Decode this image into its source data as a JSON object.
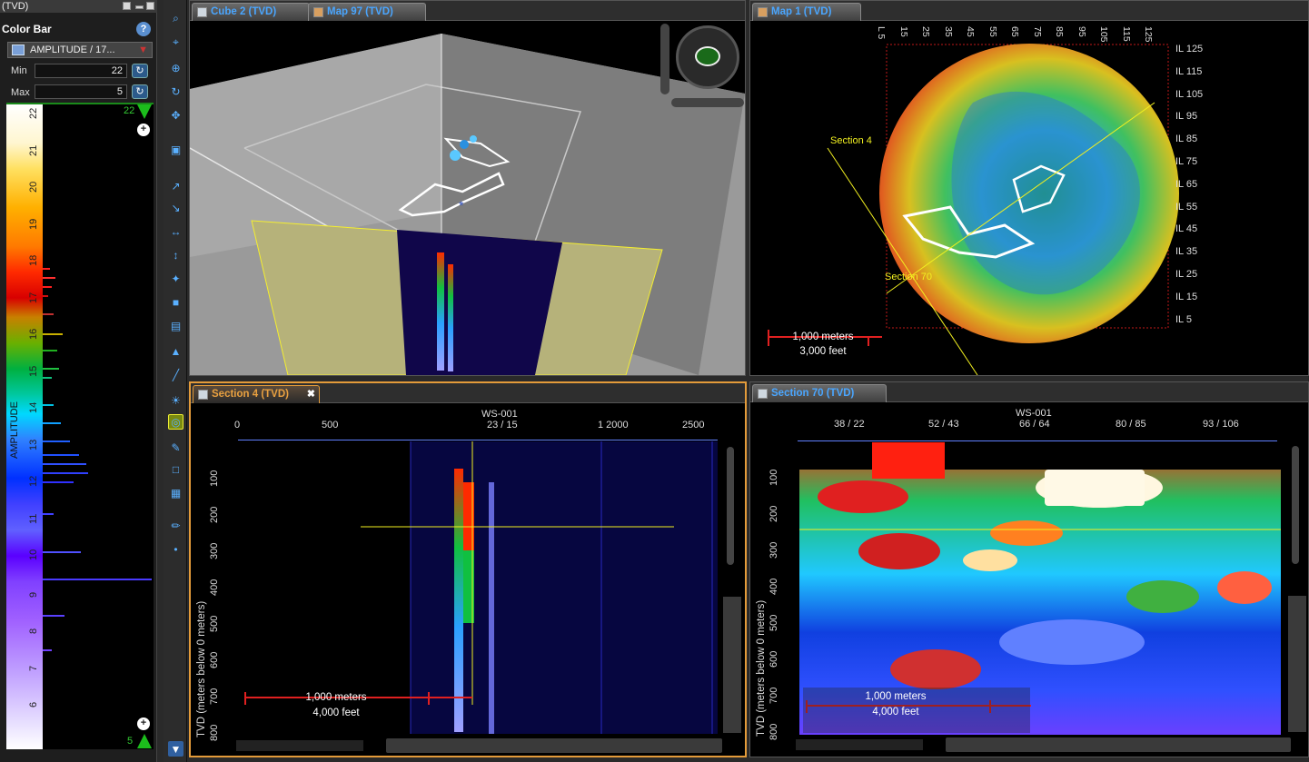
{
  "colorbar_panel": {
    "window_title": "(TVD)",
    "title": "Color Bar",
    "attribute": "AMPLITUDE / 17...",
    "min_label": "Min",
    "min_value": "22",
    "max_label": "Max",
    "max_value": "5",
    "top_marker": "22",
    "bottom_marker": "5",
    "axis_label": "AMPLITUDE",
    "ticks": [
      "22",
      "21",
      "20",
      "19",
      "18",
      "17",
      "16",
      "15",
      "14",
      "13",
      "12",
      "11",
      "10",
      "9",
      "8",
      "7",
      "6"
    ]
  },
  "cube_panel": {
    "tabs": [
      {
        "label": "Cube 2 (TVD)"
      },
      {
        "label": "Map 97 (TVD)"
      }
    ]
  },
  "map_panel": {
    "tab": "Map 1 (TVD)",
    "top_ticks": [
      "L 5",
      "15",
      "25",
      "35",
      "45",
      "55",
      "65",
      "75",
      "85",
      "95",
      "105",
      "115",
      "125"
    ],
    "right_ticks": [
      "IL 125",
      "IL 115",
      "IL 105",
      "IL 95",
      "IL 85",
      "IL 75",
      "IL 65",
      "IL 55",
      "IL 45",
      "IL 35",
      "IL 25",
      "IL 15",
      "IL 5"
    ],
    "section_label_a": "Section 4",
    "section_label_b": "Section 70",
    "scale_m": "1,000 meters",
    "scale_ft": "3,000 feet"
  },
  "section4_panel": {
    "tab": "Section 4 (TVD)",
    "well": "WS-001",
    "top_ticks": [
      "0",
      "500",
      "23 / 15",
      "1 2000",
      "2500"
    ],
    "ylabel": "TVD (meters below 0 meters)",
    "y_ticks": [
      "100",
      "200",
      "300",
      "400",
      "500",
      "600",
      "700",
      "800"
    ],
    "scale_m": "1,000 meters",
    "scale_ft": "4,000 feet"
  },
  "section70_panel": {
    "tab": "Section 70 (TVD)",
    "well": "WS-001",
    "top_ticks": [
      "38 / 22",
      "52 / 43",
      "66 / 64",
      "80 / 85",
      "93 / 106"
    ],
    "ylabel": "TVD (meters below 0 meters)",
    "y_ticks": [
      "100",
      "200",
      "300",
      "400",
      "500",
      "600",
      "700",
      "800"
    ],
    "scale_m": "1,000 meters",
    "scale_ft": "4,000 feet"
  }
}
